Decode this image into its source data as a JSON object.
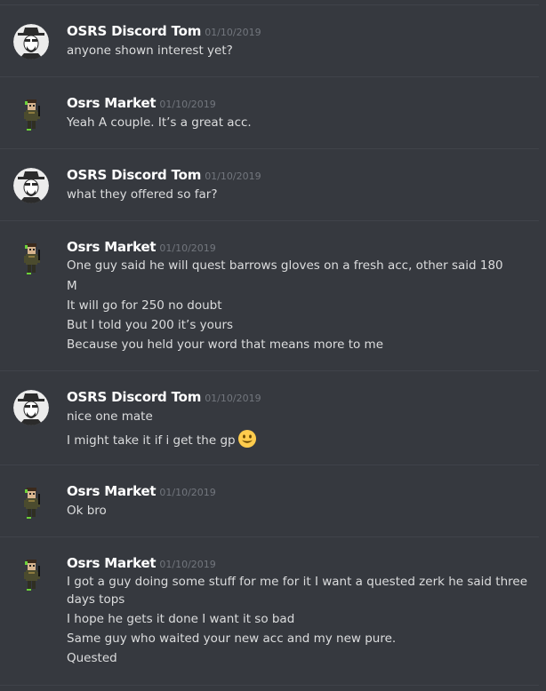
{
  "colors": {
    "background": "#36393f",
    "divider": "#40434a",
    "username": "#ffffff",
    "timestamp": "#72767d",
    "text": "#dcddde"
  },
  "messages": [
    {
      "author": "OSRS Discord Tom",
      "avatar": "heisenberg-avatar",
      "timestamp": "01/10/2019",
      "lines": [
        "anyone shown interest yet?"
      ]
    },
    {
      "author": "Osrs Market",
      "avatar": "market-avatar",
      "timestamp": "01/10/2019",
      "lines": [
        "Yeah A couple. It’s a great acc."
      ]
    },
    {
      "author": "OSRS Discord Tom",
      "avatar": "heisenberg-avatar",
      "timestamp": "01/10/2019",
      "lines": [
        "what they offered so far?"
      ]
    },
    {
      "author": "Osrs Market",
      "avatar": "market-avatar",
      "timestamp": "01/10/2019",
      "lines": [
        "One guy said he will quest barrows gloves on a fresh acc, other said 180",
        "M",
        "It will go for 250 no doubt",
        "But I told you 200 it’s yours",
        "Because you held your word that means more to me"
      ]
    },
    {
      "author": "OSRS Discord Tom",
      "avatar": "heisenberg-avatar",
      "timestamp": "01/10/2019",
      "lines": [
        "nice one mate",
        "I might take it if i get the gp"
      ],
      "emoji": "smiley-emoji-icon"
    },
    {
      "author": "Osrs Market",
      "avatar": "market-avatar",
      "timestamp": "01/10/2019",
      "lines": [
        "Ok bro"
      ]
    },
    {
      "author": "Osrs Market",
      "avatar": "market-avatar",
      "timestamp": "01/10/2019",
      "lines": [
        "I got a guy doing some stuff for me for it I want a quested zerk he said three",
        "days tops",
        "I hope he gets it done I want it so bad",
        "Same guy who waited your new acc and my new pure.",
        "Quested"
      ]
    }
  ]
}
